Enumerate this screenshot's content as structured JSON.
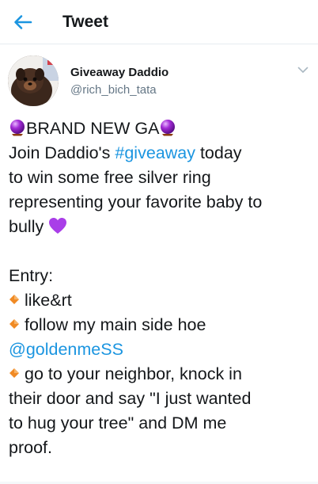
{
  "header": {
    "title": "Tweet",
    "back_icon": "arrow-left-icon",
    "accent_color": "#1b95e0"
  },
  "author": {
    "display_name": "Giveaway Daddio",
    "handle": "@rich_bich_tata",
    "menu_icon": "chevron-down-icon"
  },
  "tweet": {
    "line1_text": "BRAND NEW GA",
    "line1_emoji": "crystal-ball-emoji",
    "line2_prefix": "Join Daddio's ",
    "line2_hashtag": "#giveaway",
    "line2_suffix": " today",
    "line3": "to win some free silver ring",
    "line4": "representing your favorite baby to",
    "line5_text": "bully",
    "line5_emoji": "purple-heart-emoji",
    "entry_label": "Entry:",
    "bullet_icon": "small-orange-diamond-emoji",
    "entry1": "like&rt",
    "entry2": "follow my main side hoe",
    "entry2_mention": "@goldenmeSS",
    "entry3_line1": "go to your neighbor, knock in",
    "entry3_line2": "their door and say \"I just wanted",
    "entry3_line3": "to hug your tree\" and DM me",
    "entry3_line4": "proof."
  }
}
